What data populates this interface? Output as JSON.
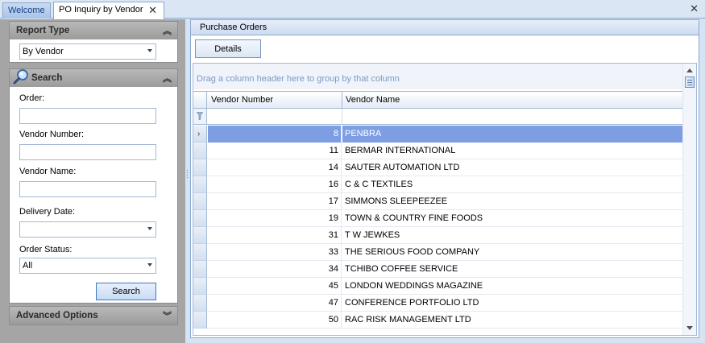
{
  "tabs": [
    {
      "label": "Welcome",
      "active": false
    },
    {
      "label": "PO Inquiry by Vendor",
      "active": true
    }
  ],
  "report_type": {
    "header": "Report Type",
    "selected": "By Vendor"
  },
  "search": {
    "header": "Search",
    "order_label": "Order:",
    "order_value": "",
    "vendor_number_label": "Vendor Number:",
    "vendor_number_value": "",
    "vendor_name_label": "Vendor Name:",
    "vendor_name_value": "",
    "delivery_date_label": "Delivery Date:",
    "delivery_date_value": "",
    "order_status_label": "Order Status:",
    "order_status_value": "All",
    "search_button": "Search"
  },
  "advanced_options": {
    "header": "Advanced Options"
  },
  "purchase_orders": {
    "header": "Purchase Orders",
    "details_button": "Details",
    "group_panel_hint": "Drag a column header here to group by that column",
    "columns": [
      "Vendor Number",
      "Vendor Name"
    ],
    "rows": [
      {
        "vendor_number": "8",
        "vendor_name": "PENBRA",
        "selected": true
      },
      {
        "vendor_number": "11",
        "vendor_name": "BERMAR INTERNATIONAL"
      },
      {
        "vendor_number": "14",
        "vendor_name": "SAUTER AUTOMATION LTD"
      },
      {
        "vendor_number": "16",
        "vendor_name": "C & C TEXTILES"
      },
      {
        "vendor_number": "17",
        "vendor_name": "SIMMONS SLEEPEEZEE"
      },
      {
        "vendor_number": "19",
        "vendor_name": "TOWN & COUNTRY FINE FOODS"
      },
      {
        "vendor_number": "31",
        "vendor_name": "T W JEWKES"
      },
      {
        "vendor_number": "33",
        "vendor_name": "THE SERIOUS FOOD COMPANY"
      },
      {
        "vendor_number": "34",
        "vendor_name": "TCHIBO COFFEE SERVICE"
      },
      {
        "vendor_number": "45",
        "vendor_name": "LONDON WEDDINGS MAGAZINE"
      },
      {
        "vendor_number": "47",
        "vendor_name": "CONFERENCE PORTFOLIO LTD"
      },
      {
        "vendor_number": "50",
        "vendor_name": "RAC RISK MANAGEMENT LTD"
      }
    ]
  },
  "colors": {
    "selected_row": "#7d9ee3",
    "tab_strip": "#dbe6f4",
    "left_panel": "#a5a5a5",
    "group_hint_text": "#7a9ac7"
  }
}
